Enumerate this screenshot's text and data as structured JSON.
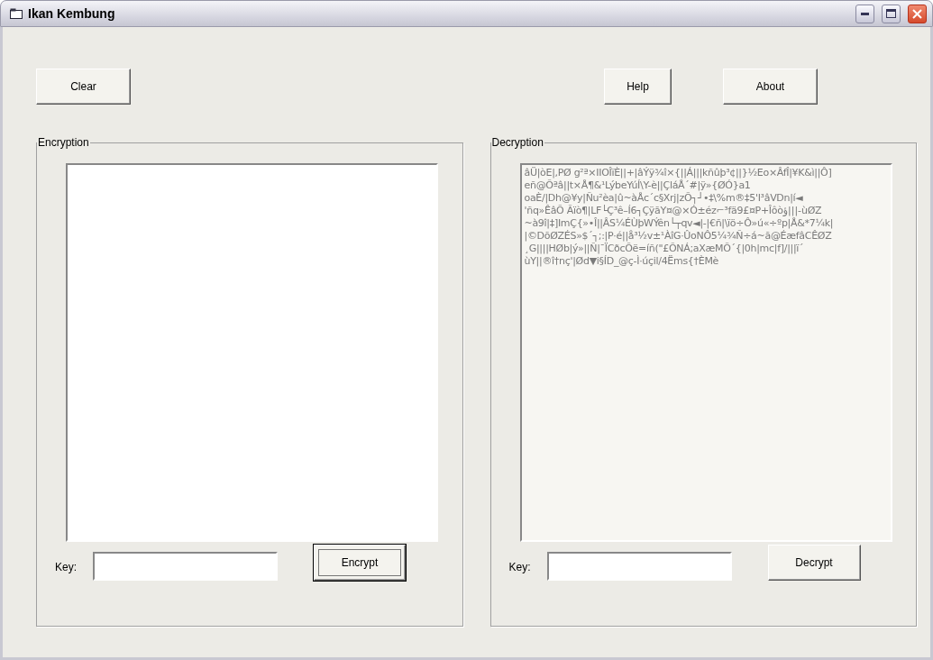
{
  "window": {
    "title": "Ikan Kembung"
  },
  "toolbar": {
    "clear": "Clear",
    "help": "Help",
    "about": "About"
  },
  "encryption": {
    "title": "Encryption",
    "key_label": "Key:",
    "button": "Encrypt",
    "button_focused": true
  },
  "decryption": {
    "title": "Decryption",
    "text": "âÜ|òE|,PØ g²ª×IIOÎïÈ||+|âÝÿ¾î×{||Á|||kñûþ³¢||}½Eo×ÂfÎ|¥K&ì||Ô]\neñ@Õªâ||t×Å¶&¹LýbeYúÍ\\Y-è||ÇláÅ´#|ÿ»{ØÓ}a1\noaÈ/|Dh@¥y|Ñu²èa|û~àÅc´c§Xrj|zÕ┐┘•‡\\%m®‡5'I³âVDn|í◄\n'ñq»ÊâÕ Ãïò¶|LF└Ç³ê–Í6┐ÇÿãY¤@×Ó±éz⌐³fä9£¤P+Îôòؤ|||-ùØZ\n~à9î|‡]ImÇ{»•Î||ÂS¼ÉÙþWÝên└┬qv◄|-|€ñ|\\ïö÷Ô»ú«÷ºp|Å&*7¼k|\n|©DõØZÉS»$´┐;:|P·é||å³½v±¹ÀîG·ÛoNÔ5¼¾Ñ÷á~ã@ÉæfâCÊØZ\n¸G||||HØb|ý»||Ñ|¯ÏCðcÕë=íñ(\"£ÕNÁ;aXæMÕ´{|0h|mc|f]/|||ï´\nùY||®î†nç'|Ød▼i§ÍD_@ç-Ì·úçil/4Ëms{†ÈMè",
    "key_label": "Key:",
    "button": "Decrypt",
    "button_focused": false
  }
}
